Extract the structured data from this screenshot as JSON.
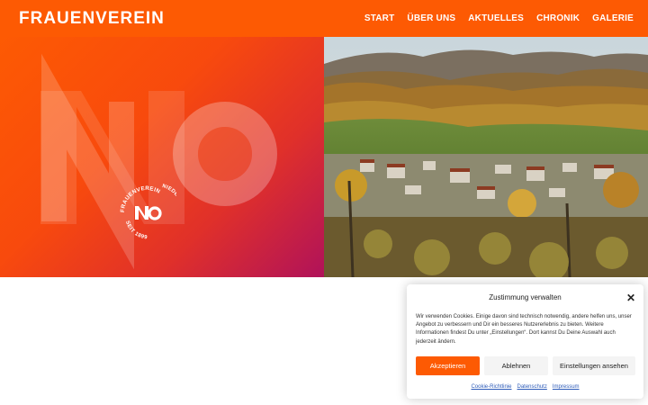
{
  "header": {
    "logo_text": "FRAUENVEREIN",
    "nav": [
      "START",
      "ÜBER UNS",
      "AKTUELLES",
      "CHRONIK",
      "GALERIE"
    ]
  },
  "badge": {
    "top_text": "FRAUENVEREIN",
    "right_text": "NIEDERWEILER",
    "bottom_text": "SEIT 1899"
  },
  "cookie": {
    "title": "Zustimmung verwalten",
    "body": "Wir verwenden Cookies. Einige davon sind technisch notwendig, andere helfen uns, unser Angebot zu verbessern und Dir ein besseres Nutzererlebnis zu bieten. Weitere Informationen findest Du unter „Einstellungen“. Dort kannst Du Deine Auswahl auch jederzeit ändern.",
    "accept_label": "Akzeptieren",
    "deny_label": "Ablehnen",
    "settings_label": "Einstellungen ansehen",
    "links": [
      "Cookie-Richtlinie",
      "Datenschutz",
      "Impressum"
    ]
  },
  "colors": {
    "brand_orange": "#fd5a03",
    "gradient_end": "#b0125a",
    "link_blue": "#2d5bb8"
  }
}
